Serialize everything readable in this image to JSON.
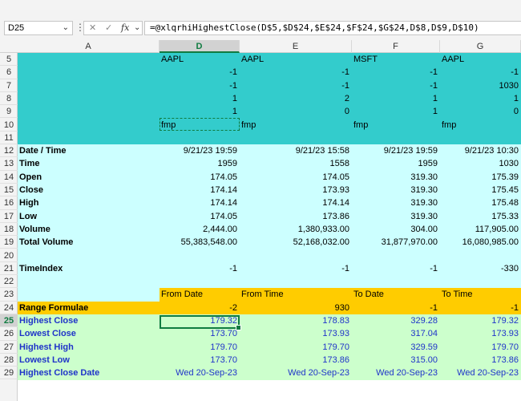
{
  "formula_bar": {
    "name_box": "D25",
    "name_dropdown_glyph": "⌄",
    "dots_glyph": "⋮",
    "cancel_glyph": "✕",
    "enter_glyph": "✓",
    "fx_glyph": "fx",
    "fx_dropdown_glyph": "⌄",
    "formula": "=@xlqrhiHighestClose(D$5,$D$24,$E$24,$F$24,$G$24,D$8,D$9,D$10)"
  },
  "columns": [
    {
      "id": "A",
      "label": "A"
    },
    {
      "id": "D",
      "label": "D",
      "selected": true
    },
    {
      "id": "E",
      "label": "E"
    },
    {
      "id": "F",
      "label": "F"
    },
    {
      "id": "G",
      "label": "G"
    }
  ],
  "rows": [
    {
      "num": "5",
      "kind": "teal",
      "label": "",
      "D": "AAPL",
      "E": "AAPL",
      "F": "MSFT",
      "G": "AAPL",
      "align": "left"
    },
    {
      "num": "6",
      "kind": "teal",
      "label": "",
      "D": "-1",
      "E": "-1",
      "F": "-1",
      "G": "-1",
      "align": "right"
    },
    {
      "num": "7",
      "kind": "teal",
      "label": "",
      "D": "-1",
      "E": "-1",
      "F": "-1",
      "G": "1030",
      "align": "right"
    },
    {
      "num": "8",
      "kind": "teal",
      "label": "",
      "D": "1",
      "E": "2",
      "F": "1",
      "G": "1",
      "align": "right"
    },
    {
      "num": "9",
      "kind": "teal",
      "label": "",
      "D": "1",
      "E": "0",
      "F": "1",
      "G": "0",
      "align": "right"
    },
    {
      "num": "10",
      "kind": "teal",
      "label": "",
      "D": "fmp",
      "E": "fmp",
      "F": "fmp",
      "G": "fmp",
      "align": "left"
    },
    {
      "num": "11",
      "kind": "teal",
      "label": "",
      "D": "",
      "E": "",
      "F": "",
      "G": "",
      "align": "right"
    },
    {
      "num": "12",
      "kind": "cyan",
      "label": "Date / Time",
      "D": "9/21/23 19:59",
      "E": "9/21/23 15:58",
      "F": "9/21/23 19:59",
      "G": "9/21/23 10:30",
      "align": "right"
    },
    {
      "num": "13",
      "kind": "cyan",
      "label": "Time",
      "D": "1959",
      "E": "1558",
      "F": "1959",
      "G": "1030",
      "align": "right"
    },
    {
      "num": "14",
      "kind": "cyan",
      "label": "Open",
      "D": "174.05",
      "E": "174.05",
      "F": "319.30",
      "G": "175.39",
      "align": "right"
    },
    {
      "num": "15",
      "kind": "cyan",
      "label": "Close",
      "D": "174.14",
      "E": "173.93",
      "F": "319.30",
      "G": "175.45",
      "align": "right"
    },
    {
      "num": "16",
      "kind": "cyan",
      "label": "High",
      "D": "174.14",
      "E": "174.14",
      "F": "319.30",
      "G": "175.48",
      "align": "right"
    },
    {
      "num": "17",
      "kind": "cyan",
      "label": "Low",
      "D": "174.05",
      "E": "173.86",
      "F": "319.30",
      "G": "175.33",
      "align": "right"
    },
    {
      "num": "18",
      "kind": "cyan",
      "label": "Volume",
      "D": "2,444.00",
      "E": "1,380,933.00",
      "F": "304.00",
      "G": "117,905.00",
      "align": "right"
    },
    {
      "num": "19",
      "kind": "cyan",
      "label": "Total Volume",
      "D": "55,383,548.00",
      "E": "52,168,032.00",
      "F": "31,877,970.00",
      "G": "16,080,985.00",
      "align": "right"
    },
    {
      "num": "20",
      "kind": "cyan",
      "label": "",
      "D": "",
      "E": "",
      "F": "",
      "G": "",
      "align": "right"
    },
    {
      "num": "21",
      "kind": "cyan",
      "label": "TimeIndex",
      "D": "-1",
      "E": "-1",
      "F": "-1",
      "G": "-330",
      "align": "right"
    },
    {
      "num": "22",
      "kind": "cyan",
      "label": "",
      "D": "",
      "E": "",
      "F": "",
      "G": "",
      "align": "right"
    },
    {
      "num": "23",
      "kind": "cyan",
      "label": "",
      "D": "From Date",
      "E": "From Time",
      "F": "To Date",
      "G": "To Time",
      "align": "left",
      "header_gold": true
    },
    {
      "num": "24",
      "kind": "gold",
      "label": "Range Formulae",
      "D": "-2",
      "E": "930",
      "F": "-1",
      "G": "-1",
      "align": "right"
    },
    {
      "num": "25",
      "kind": "green",
      "label": "Highest Close",
      "D": "179.32",
      "E": "178.83",
      "F": "329.28",
      "G": "179.32",
      "align": "right"
    },
    {
      "num": "26",
      "kind": "green",
      "label": "Lowest Close",
      "D": "173.70",
      "E": "173.93",
      "F": "317.04",
      "G": "173.93",
      "align": "right"
    },
    {
      "num": "27",
      "kind": "green",
      "label": "Highest High",
      "D": "179.70",
      "E": "179.70",
      "F": "329.59",
      "G": "179.70",
      "align": "right"
    },
    {
      "num": "28",
      "kind": "green",
      "label": "Lowest Low",
      "D": "173.70",
      "E": "173.86",
      "F": "315.00",
      "G": "173.86",
      "align": "right"
    },
    {
      "num": "29",
      "kind": "green",
      "label": "Highest Close Date",
      "D": "Wed 20-Sep-23",
      "E": "Wed 20-Sep-23",
      "F": "Wed 20-Sep-23",
      "G": "Wed 20-Sep-23",
      "align": "right"
    }
  ],
  "colors": {
    "teal": "#33cccc",
    "cyan": "#ccffff",
    "gold": "#ffcc00",
    "green": "#ccffcc",
    "label_blue": "#1f33c9",
    "selection_green": "#107c41"
  }
}
